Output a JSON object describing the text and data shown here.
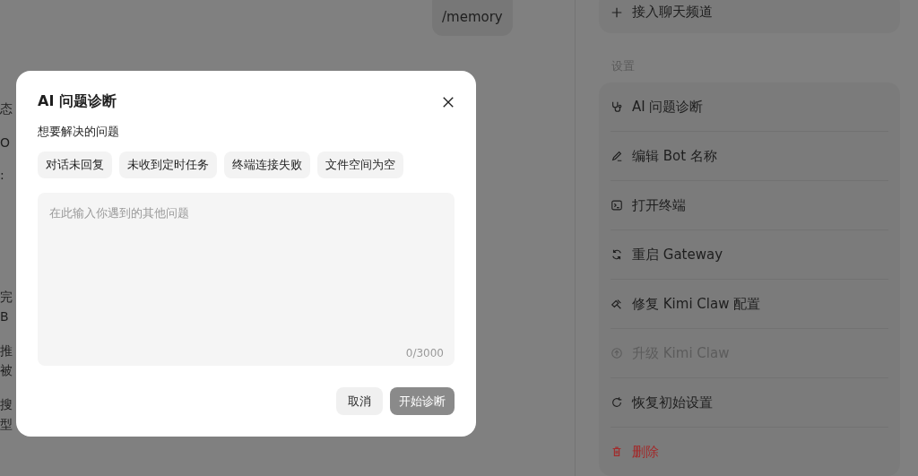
{
  "chat": {
    "user_message": "/memory",
    "fragments": [
      "态",
      "O",
      ":",
      "完",
      "B",
      "推",
      "被",
      "搜",
      "型"
    ]
  },
  "sidebar": {
    "add_channel": "接入聊天频道",
    "section_title": "设置",
    "items": [
      {
        "label": "AI 问题诊断",
        "kind": "normal",
        "disabled": false
      },
      {
        "label": "编辑 Bot 名称",
        "kind": "normal",
        "disabled": false
      },
      {
        "label": "打开终端",
        "kind": "normal",
        "disabled": false
      },
      {
        "label": "重启 Gateway",
        "kind": "normal",
        "disabled": false
      },
      {
        "label": "修复 Kimi Claw 配置",
        "kind": "normal",
        "disabled": false
      },
      {
        "label": "升级 Kimi Claw",
        "kind": "normal",
        "disabled": true
      },
      {
        "label": "恢复初始设置",
        "kind": "normal",
        "disabled": false
      },
      {
        "label": "删除",
        "kind": "danger",
        "disabled": false
      }
    ]
  },
  "dialog": {
    "title": "AI 问题诊断",
    "subtitle": "想要解决的问题",
    "chips": [
      {
        "label": "对话未回复",
        "selected": false
      },
      {
        "label": "未收到定时任务",
        "selected": false
      },
      {
        "label": "终端连接失败",
        "selected": false
      },
      {
        "label": "文件空间为空",
        "selected": false
      }
    ],
    "textarea": {
      "placeholder": "在此输入你遇到的其他问题",
      "counter": "0/3000"
    },
    "buttons": [
      {
        "label": "取消",
        "kind": "secondary",
        "disabled": false
      },
      {
        "label": "开始诊断",
        "kind": "primary",
        "disabled": true
      }
    ]
  }
}
